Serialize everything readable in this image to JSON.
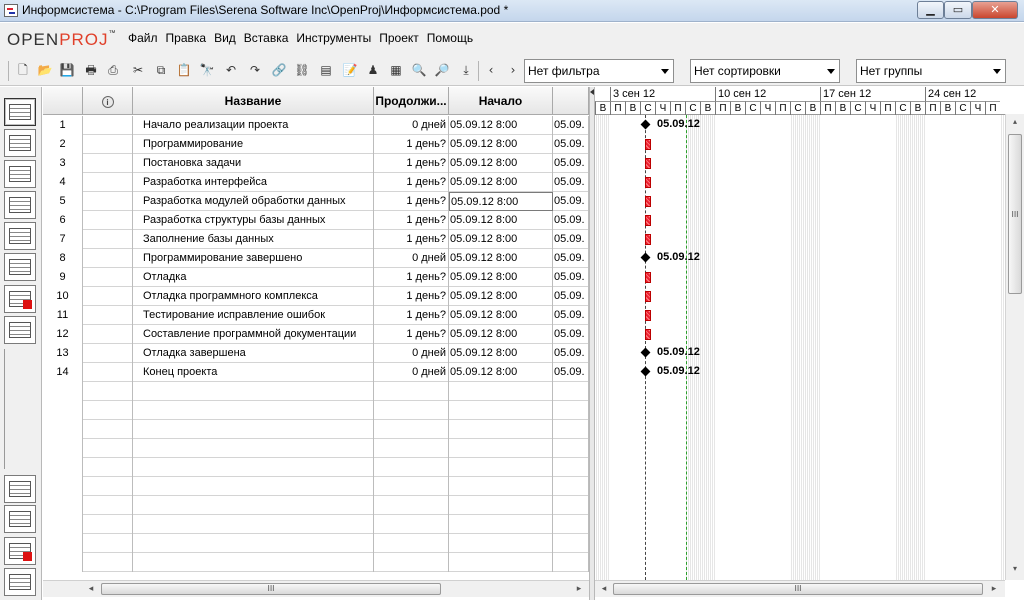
{
  "window": {
    "title": "Информсистема - C:\\Program Files\\Serena Software Inc\\OpenProj\\Информсистема.pod *",
    "minimize": "▁",
    "maximize": "▭",
    "close": "✕"
  },
  "logo": {
    "open": "OPEN",
    "proj": "PROJ",
    "tm": "™"
  },
  "menu": [
    "Файл",
    "Правка",
    "Вид",
    "Вставка",
    "Инструменты",
    "Проект",
    "Помощь"
  ],
  "toolbar": {
    "filter": "Нет фильтра",
    "sort": "Нет сортировки",
    "group": "Нет группы"
  },
  "table": {
    "columns": {
      "indicator": "i",
      "name": "Название",
      "duration": "Продолжи...",
      "start": "Начало"
    },
    "rows": [
      {
        "id": "1",
        "name": "Начало реализации проекта",
        "duration": "0 дней",
        "start": "05.09.12 8:00",
        "end": "05.09."
      },
      {
        "id": "2",
        "name": "Программирование",
        "duration": "1 день?",
        "start": "05.09.12 8:00",
        "end": "05.09."
      },
      {
        "id": "3",
        "name": "Постановка задачи",
        "duration": "1 день?",
        "start": "05.09.12 8:00",
        "end": "05.09."
      },
      {
        "id": "4",
        "name": "Разработка интерфейса",
        "duration": "1 день?",
        "start": "05.09.12 8:00",
        "end": "05.09."
      },
      {
        "id": "5",
        "name": "Разработка модулей обработки данных",
        "duration": "1 день?",
        "start": "05.09.12 8:00",
        "end": "05.09."
      },
      {
        "id": "6",
        "name": "Разработка структуры  базы данных",
        "duration": "1 день?",
        "start": "05.09.12 8:00",
        "end": "05.09."
      },
      {
        "id": "7",
        "name": "Заполнение базы данных",
        "duration": "1 день?",
        "start": "05.09.12 8:00",
        "end": "05.09."
      },
      {
        "id": "8",
        "name": "Программирование завершено",
        "duration": "0 дней",
        "start": "05.09.12 8:00",
        "end": "05.09."
      },
      {
        "id": "9",
        "name": "Отладка",
        "duration": "1 день?",
        "start": "05.09.12 8:00",
        "end": "05.09."
      },
      {
        "id": "10",
        "name": "Отладка программного комплекса",
        "duration": "1 день?",
        "start": "05.09.12 8:00",
        "end": "05.09."
      },
      {
        "id": "11",
        "name": "Тестирование исправление ошибок",
        "duration": "1 день?",
        "start": "05.09.12 8:00",
        "end": "05.09."
      },
      {
        "id": "12",
        "name": "Составление программной документации",
        "duration": "1 день?",
        "start": "05.09.12 8:00",
        "end": "05.09."
      },
      {
        "id": "13",
        "name": "Отладка завершена",
        "duration": "0 дней",
        "start": "05.09.12 8:00",
        "end": "05.09."
      },
      {
        "id": "14",
        "name": "Конец проекта",
        "duration": "0 дней",
        "start": "05.09.12 8:00",
        "end": "05.09."
      }
    ],
    "selected_row": 5
  },
  "gantt": {
    "weeks": [
      "3 сен 12",
      "10 сен 12",
      "17 сен 12",
      "24 сен 12"
    ],
    "day_letters": [
      "П",
      "В",
      "С",
      "Ч",
      "П",
      "С",
      "В"
    ],
    "first_day_letter": "В",
    "milestone_label": "05.09.12",
    "rows": [
      {
        "kind": "milestone",
        "label": "05.09.12"
      },
      {
        "kind": "task"
      },
      {
        "kind": "task"
      },
      {
        "kind": "task"
      },
      {
        "kind": "task"
      },
      {
        "kind": "task"
      },
      {
        "kind": "task"
      },
      {
        "kind": "milestone",
        "label": "05.09.12"
      },
      {
        "kind": "task"
      },
      {
        "kind": "task"
      },
      {
        "kind": "task"
      },
      {
        "kind": "task"
      },
      {
        "kind": "milestone",
        "label": "05.09.12"
      },
      {
        "kind": "milestone",
        "label": "05.09.12"
      }
    ]
  },
  "scroll": {
    "grip": "III",
    "left": "◂",
    "right": "▸",
    "up": "▴",
    "down": "▾"
  },
  "colors": {
    "accent_red": "#e0402a",
    "task_bar": "#e22233",
    "today_line": "#2ca02c"
  }
}
